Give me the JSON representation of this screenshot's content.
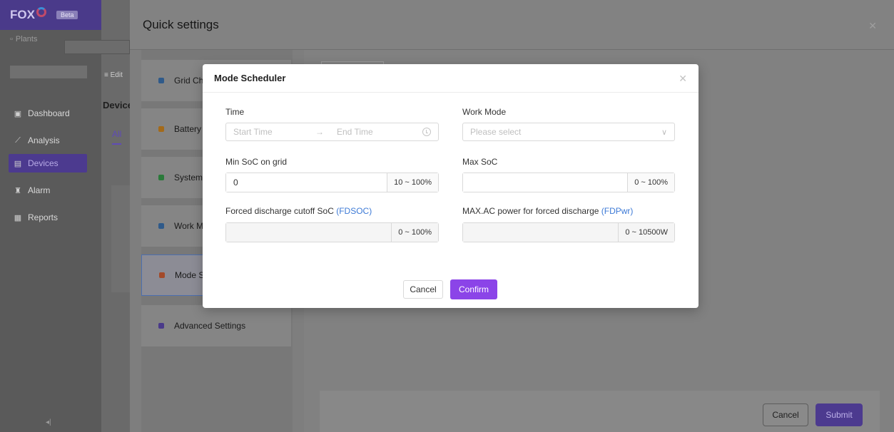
{
  "app": {
    "logo": "FOX",
    "badge": "Beta",
    "plants_label": "Plants",
    "edit_label": "Edit",
    "nav": [
      {
        "label": "Dashboard",
        "icon": "dashboard-icon"
      },
      {
        "label": "Analysis",
        "icon": "analysis-icon"
      },
      {
        "label": "Devices",
        "icon": "devices-icon"
      },
      {
        "label": "Alarm",
        "icon": "alarm-icon"
      },
      {
        "label": "Reports",
        "icon": "reports-icon"
      }
    ],
    "active_nav": "Devices",
    "device_heading": "Device",
    "all_tab": "All"
  },
  "drawer": {
    "title": "Quick settings",
    "items": [
      {
        "label": "Grid Charge",
        "color": "#2f5a8a"
      },
      {
        "label": "Battery Protection",
        "color": "#a36a1a"
      },
      {
        "label": "System Mode",
        "color": "#2a7a3a"
      },
      {
        "label": "Work Mode",
        "color": "#2f5a8a"
      },
      {
        "label": "Mode Scheduler",
        "color": "#a34a2a"
      },
      {
        "label": "Advanced Settings",
        "color": "#4a3a8a"
      }
    ],
    "selected": "Mode Scheduler",
    "cancel_label": "Cancel",
    "submit_label": "Submit"
  },
  "modal": {
    "title": "Mode Scheduler",
    "time": {
      "label": "Time",
      "start_placeholder": "Start Time",
      "separator": "→",
      "end_placeholder": "End Time"
    },
    "work_mode": {
      "label": "Work Mode",
      "placeholder": "Please select"
    },
    "min_soc": {
      "label": "Min SoC on grid",
      "value": "0",
      "range": "10 ~ 100%"
    },
    "max_soc": {
      "label": "Max SoC",
      "value": "",
      "range": "0 ~ 100%"
    },
    "fdsoc": {
      "label": "Forced discharge cutoff SoC ",
      "abbr": "(FDSOC)",
      "value": "",
      "range": "0 ~ 100%"
    },
    "fdpwr": {
      "label": "MAX.AC power for forced discharge ",
      "abbr": "(FDPwr)",
      "value": "",
      "range": "0 ~ 10500W"
    },
    "cancel_label": "Cancel",
    "confirm_label": "Confirm"
  },
  "colors": {
    "accent": "#8b44e8",
    "link": "#3d7ad6"
  }
}
